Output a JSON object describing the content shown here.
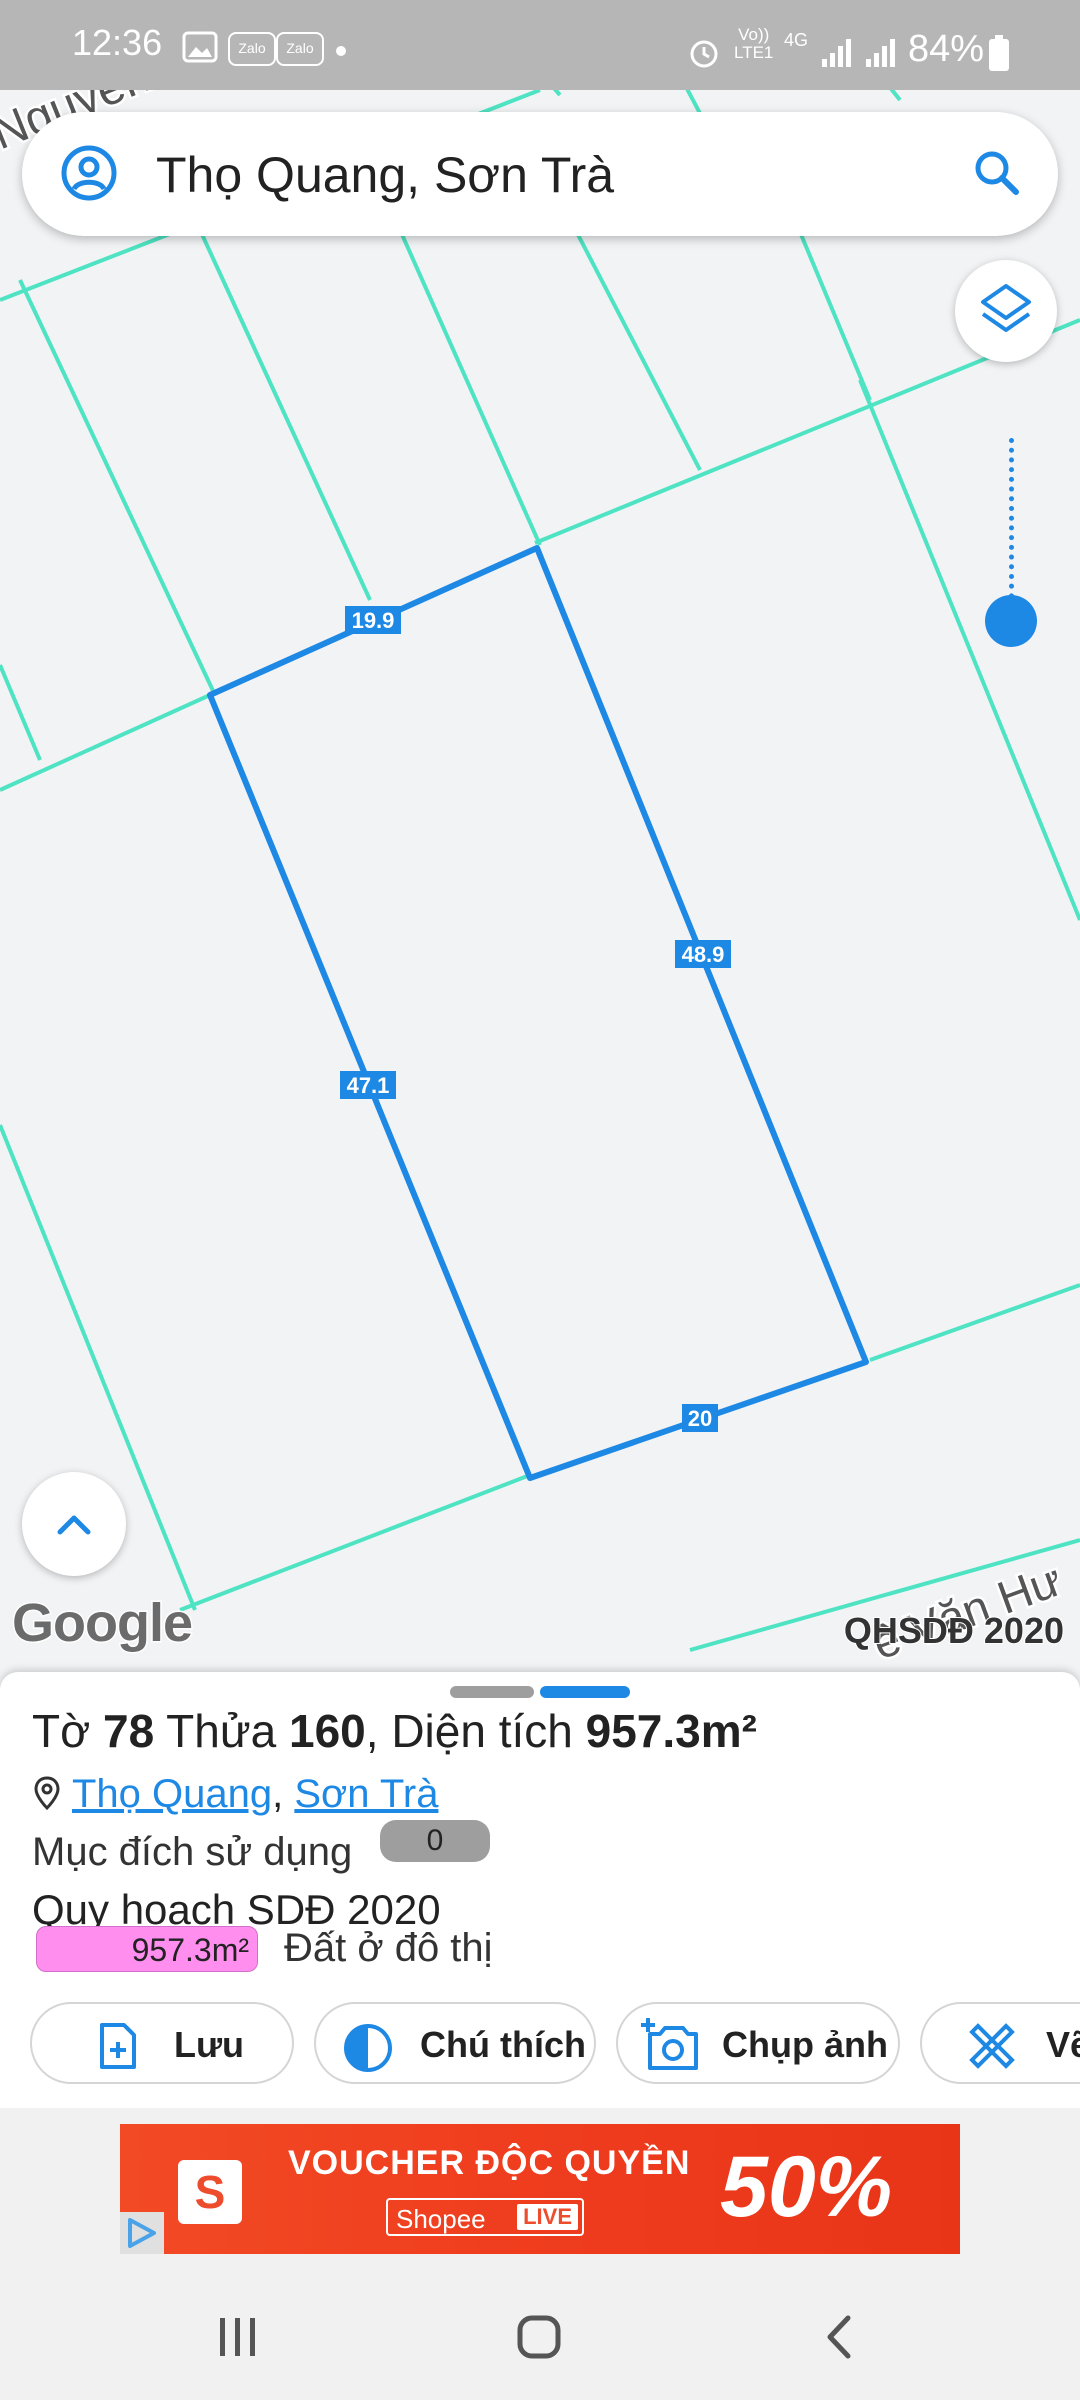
{
  "status_bar": {
    "time": "12:36",
    "network": "4G",
    "network_sub": "LTE1",
    "volte": "Vo))",
    "battery": "84%",
    "icons": [
      "gallery-icon",
      "zalo-icon",
      "zalo-icon",
      "alarm-icon",
      "signal-icon",
      "signal-icon",
      "battery-icon"
    ],
    "zalo_label": "Zalo"
  },
  "map": {
    "street_labels": [
      "Nguyễn Trực",
      "ê Văn Hư"
    ],
    "parcel_edges": [
      "19.9",
      "48.9",
      "47.1",
      "20"
    ],
    "attribution": "Google",
    "layer_name": "QHSDĐ 2020",
    "colors": {
      "parcel_outline": "#1e88e5",
      "neighbor_lines": "#4ee3c2",
      "background": "#f2f3f5"
    }
  },
  "search": {
    "value": "Thọ Quang, Sơn Trà",
    "left_icon": "account-circle-icon",
    "right_icon": "search-icon"
  },
  "sheet": {
    "to_label": "Tờ",
    "to_value": "78",
    "thua_label": "Thửa",
    "thua_value": "160",
    "area_label": "Diện tích",
    "area_value": "957.3m²",
    "ward": "Thọ Quang",
    "district": "Sơn Trà",
    "purpose_label": "Mục đích sử dụng",
    "purpose_badge": "0",
    "plan_title": "Quy hoạch SDĐ 2020",
    "plan_area": "957.3m²",
    "plan_landuse": "Đất ở đô thị",
    "plan_color": "#ff8eef",
    "buttons": [
      {
        "label": "Lưu",
        "icon": "add-file-icon"
      },
      {
        "label": "Chú thích",
        "icon": "half-circle-icon"
      },
      {
        "label": "Chụp ảnh",
        "icon": "add-camera-icon"
      },
      {
        "label": "Vẽ",
        "icon": "ruler-pencil-icon"
      }
    ]
  },
  "ad": {
    "headline": "VOUCHER ĐỘC QUYỀN",
    "brand": "Shopee",
    "live": "LIVE",
    "percent": "50%",
    "bag_letter": "S"
  }
}
